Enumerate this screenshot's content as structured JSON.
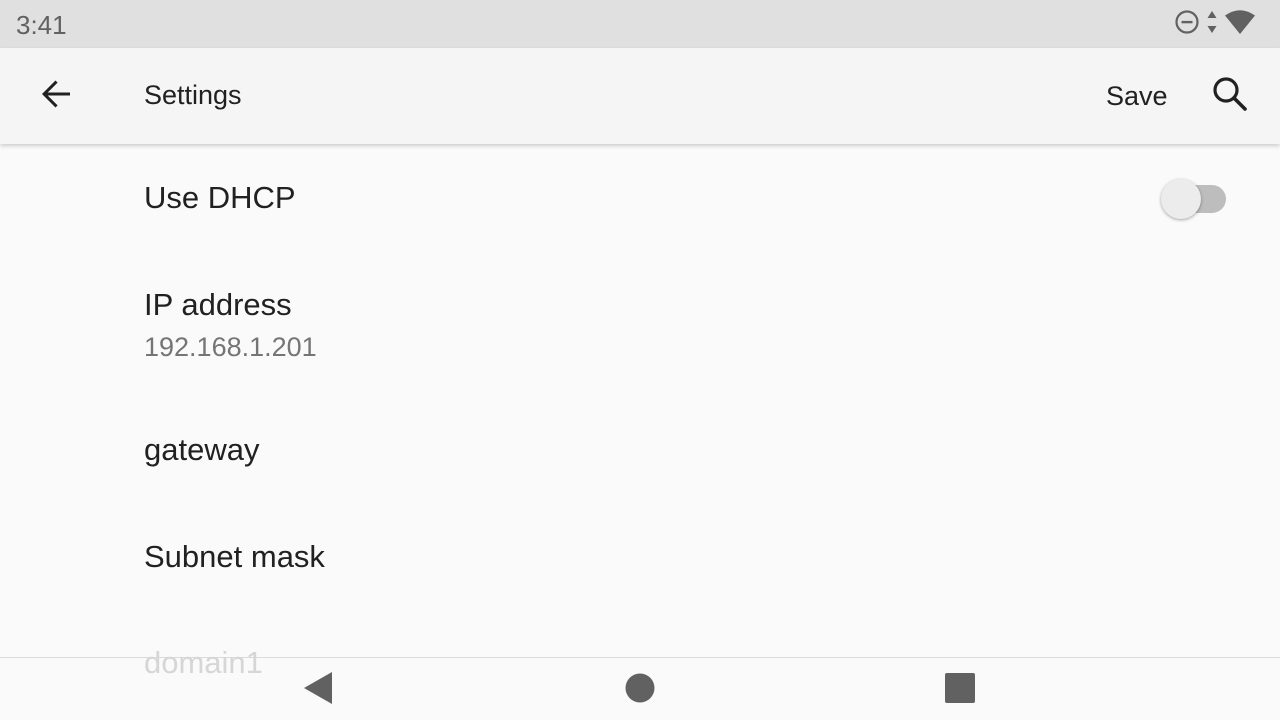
{
  "status_bar": {
    "time": "3:41",
    "icons": [
      "do-not-disturb-icon",
      "data-transfer-icon",
      "wifi-icon"
    ]
  },
  "app_bar": {
    "back_icon": "arrow-back-icon",
    "title": "Settings",
    "save_label": "Save",
    "search_icon": "search-icon"
  },
  "preferences": [
    {
      "title": "Use DHCP",
      "type": "switch",
      "checked": false
    },
    {
      "title": "IP address",
      "summary": "192.168.1.201"
    },
    {
      "title": "gateway"
    },
    {
      "title": "Subnet mask"
    },
    {
      "title": "domain1"
    }
  ],
  "nav_bar": {
    "back_icon": "nav-back-icon",
    "home_icon": "nav-home-icon",
    "recents_icon": "nav-recents-icon"
  },
  "colors": {
    "status_bar_bg": "#e0e0e0",
    "app_bar_bg": "#f5f5f5",
    "background": "#fafafa",
    "text_primary": "#212121",
    "text_secondary": "#757575",
    "nav_icon": "#616161"
  }
}
